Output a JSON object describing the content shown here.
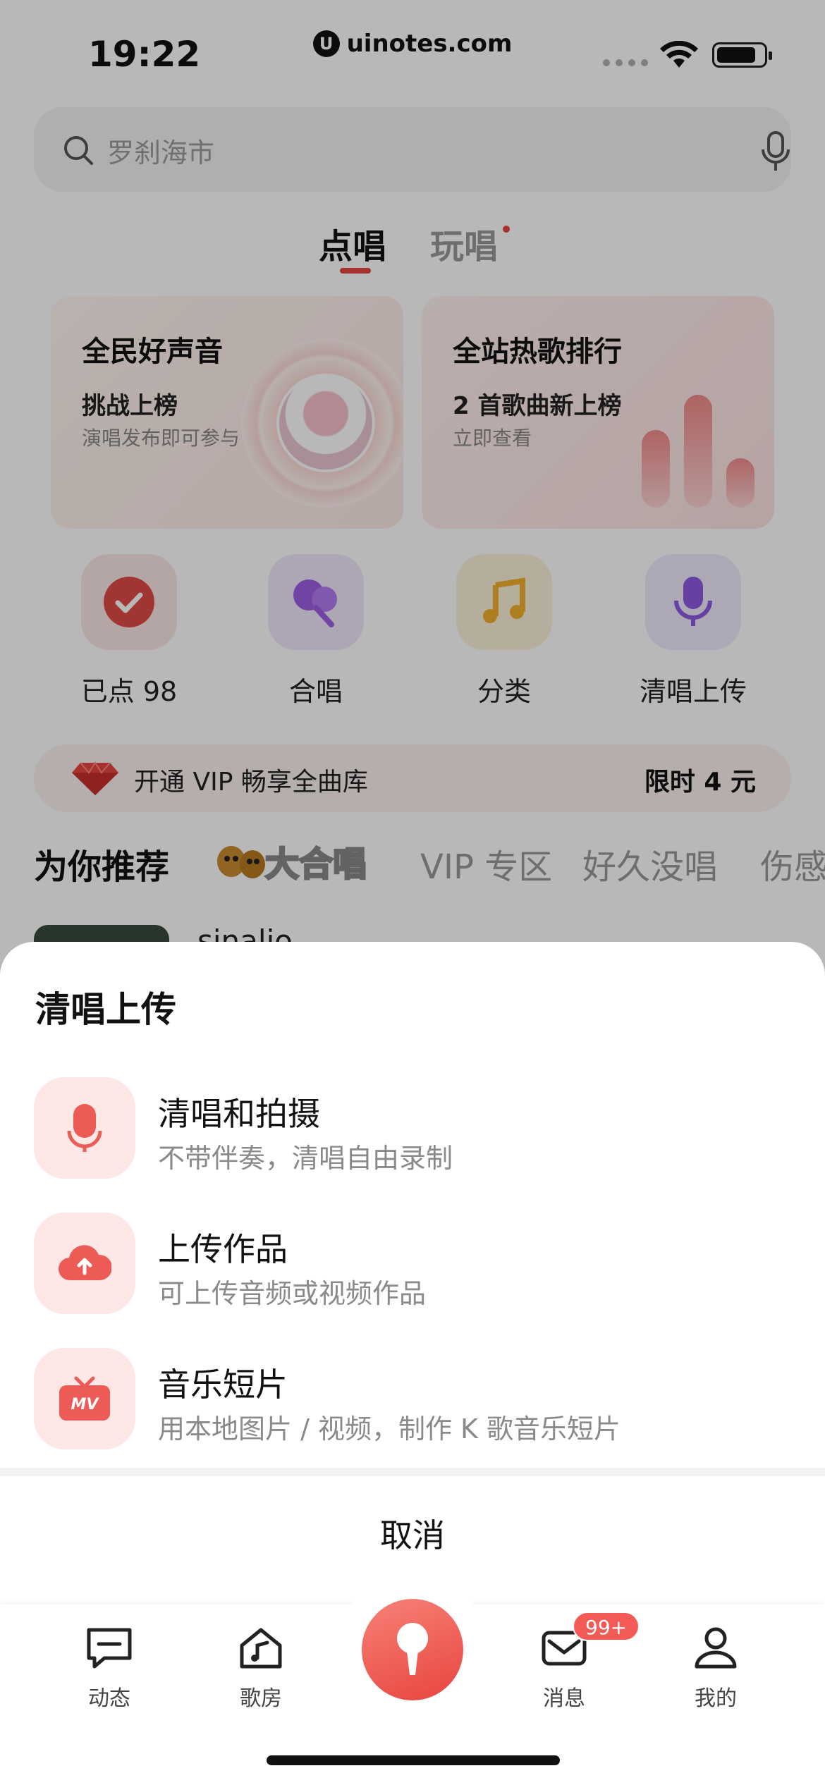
{
  "status_bar": {
    "time": "19:22",
    "watermark": "uinotes.com",
    "watermark_logo": "U"
  },
  "search": {
    "placeholder": "罗刹海市"
  },
  "tabs": [
    {
      "label": "点唱",
      "active": true
    },
    {
      "label": "玩唱",
      "active": false
    }
  ],
  "cards": [
    {
      "title": "全民好声音",
      "subtitle": "挑战上榜",
      "desc": "演唱发布即可参与"
    },
    {
      "title": "全站热歌排行",
      "subtitle": "2 首歌曲新上榜",
      "desc": "立即查看"
    }
  ],
  "shortcuts": [
    {
      "label": "已点 98",
      "icon": "check-icon"
    },
    {
      "label": "合唱",
      "icon": "duet-icon"
    },
    {
      "label": "分类",
      "icon": "music-note-icon"
    },
    {
      "label": "清唱上传",
      "icon": "microphone-icon"
    }
  ],
  "vip_banner": {
    "text": "开通 VIP 畅享全曲库",
    "price": "限时 4 元"
  },
  "recommend": {
    "title": "为你推荐",
    "chorus": "大合唱",
    "tabs": [
      "VIP 专区",
      "好久没唱",
      "伤感"
    ]
  },
  "song_peek": {
    "name": "sinalio"
  },
  "sheet": {
    "title": "清唱上传",
    "options": [
      {
        "title": "清唱和拍摄",
        "desc": "不带伴奏，清唱自由录制",
        "icon": "microphone-icon"
      },
      {
        "title": "上传作品",
        "desc": "可上传音频或视频作品",
        "icon": "cloud-upload-icon"
      },
      {
        "title": "音乐短片",
        "desc": "用本地图片 / 视频，制作 K 歌音乐短片",
        "icon": "mv-tv-icon",
        "icon_text": "MV"
      }
    ],
    "cancel": "取消"
  },
  "tabbar": {
    "items": [
      {
        "label": "动态",
        "icon": "message-square-icon"
      },
      {
        "label": "歌房",
        "icon": "home-music-icon"
      },
      {
        "label": "",
        "icon": "record-mic-icon"
      },
      {
        "label": "消息",
        "icon": "mail-icon"
      },
      {
        "label": "我的",
        "icon": "user-icon"
      }
    ],
    "badge": "99+"
  },
  "colors": {
    "accent": "#e8443f",
    "sheet_icon_bg": "#fde8e6",
    "overlay": "rgba(0,0,0,0.28)"
  }
}
